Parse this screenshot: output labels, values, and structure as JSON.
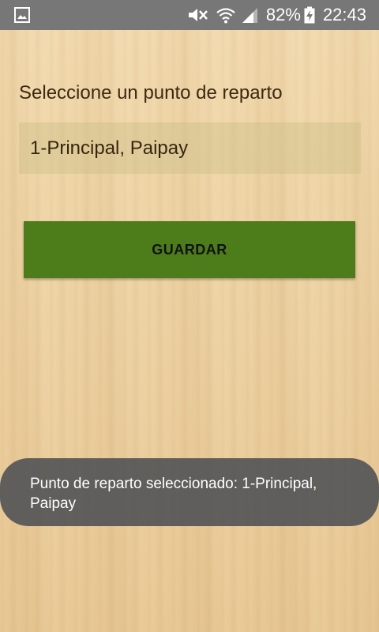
{
  "status_bar": {
    "left_icon": "image-icon",
    "icons": [
      "mute-icon",
      "wifi-icon",
      "signal-icon",
      "battery-charging-icon"
    ],
    "battery_percent": "82%",
    "time": "22:43"
  },
  "main": {
    "prompt_label": "Seleccione un punto de reparto",
    "spinner": {
      "selected_value": "1-Principal, Paipay"
    },
    "save_button": {
      "label": "GUARDAR",
      "color": "#4d7c1a"
    }
  },
  "toast": {
    "message": "Punto de reparto seleccionado: 1-Principal, Paipay"
  }
}
